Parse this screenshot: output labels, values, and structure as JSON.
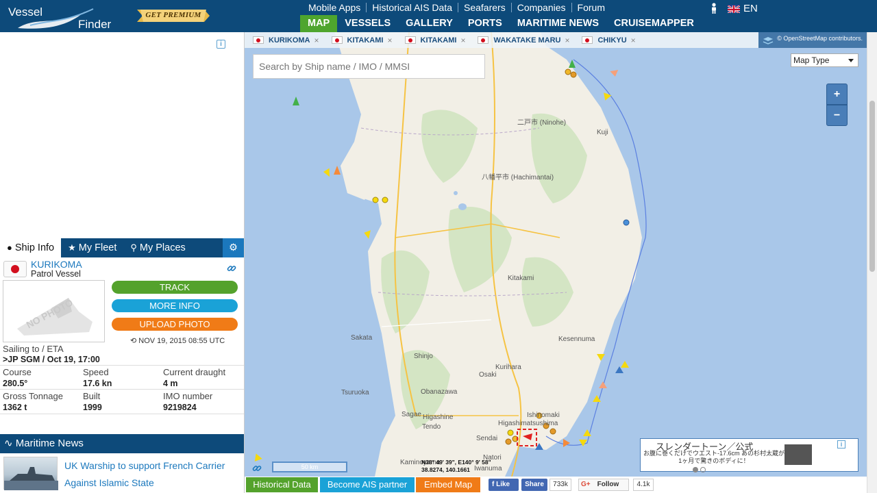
{
  "header": {
    "logo_top": "Vessel",
    "logo_bottom": "Finder",
    "premium_label": "GET PREMIUM",
    "top_links": [
      "Mobile Apps",
      "Historical AIS Data",
      "Seafarers",
      "Companies",
      "Forum"
    ],
    "main_nav": [
      "MAP",
      "VESSELS",
      "GALLERY",
      "PORTS",
      "MARITIME NEWS",
      "CRUISEMAPPER"
    ],
    "active_nav": "MAP",
    "language": "EN"
  },
  "sidebar": {
    "tabs": [
      "Ship Info",
      "My Fleet",
      "My Places"
    ],
    "ship": {
      "name": "KURIKOMA",
      "type": "Patrol Vessel",
      "no_photo_text": "NO PHOTO",
      "buttons": [
        "TRACK",
        "MORE INFO",
        "UPLOAD PHOTO"
      ],
      "date": "NOV 19, 2015 08:55 UTC",
      "eta_label": "Sailing to / ETA",
      "eta_value": ">JP SGM / Oct 19, 17:00",
      "stats": [
        {
          "label": "Course",
          "value": "280.5°"
        },
        {
          "label": "Speed",
          "value": "17.6 kn"
        },
        {
          "label": "Current draught",
          "value": "4 m"
        },
        {
          "label": "Gross Tonnage",
          "value": "1362 t"
        },
        {
          "label": "Built",
          "value": "1999"
        },
        {
          "label": "IMO number",
          "value": "9219824"
        }
      ]
    },
    "news": {
      "heading": "Maritime News",
      "title": "UK Warship to support French Carrier Against Islamic State"
    }
  },
  "map": {
    "ship_tabs": [
      "KURIKOMA",
      "KITAKAMI",
      "KITAKAMI",
      "WAKATAKE MARU",
      "CHIKYU"
    ],
    "credit": "© OpenStreetMap contributors.",
    "search_placeholder": "Search by Ship name / IMO / MMSI",
    "map_type": "Map Type",
    "zoom_in": "+",
    "zoom_out": "−",
    "scale": "50 km",
    "coords_line1": "N38° 49' 39\", E140° 9' 58\"",
    "coords_line2": "38.8274, 140.1661",
    "places": [
      {
        "name": "二戸市 (Ninohe)"
      },
      {
        "name": "Kuji"
      },
      {
        "name": "八幡平市 (Hachimantai)"
      },
      {
        "name": "Kitakami"
      },
      {
        "name": "Kesennuma"
      },
      {
        "name": "Sakata"
      },
      {
        "name": "Shinjo"
      },
      {
        "name": "Kurihara"
      },
      {
        "name": "Osaki"
      },
      {
        "name": "Tsuruoka"
      },
      {
        "name": "Obanazawa"
      },
      {
        "name": "Sagae"
      },
      {
        "name": "Higashine"
      },
      {
        "name": "Tendo"
      },
      {
        "name": "Sendai"
      },
      {
        "name": "Ishinomaki"
      },
      {
        "name": "Higashimatsushima"
      },
      {
        "name": "Natori"
      },
      {
        "name": "Kaminoyama"
      },
      {
        "name": "Iwanuma"
      }
    ],
    "ad": {
      "title": "スレンダートーン／公式",
      "text": "お腹に巻くだけでウエスト-17.6cm あの杉村太蔵が1ヶ月で驚きのボディに！"
    }
  },
  "bottom_bar": {
    "historical": "Historical Data",
    "ais_partner": "Become AIS partner",
    "embed": "Embed Map",
    "fb_like": "Like",
    "fb_share": "Share",
    "fb_count": "733k",
    "gplus_follow": "Follow",
    "gplus_count": "4.1k"
  },
  "colors": {
    "header_bg": "#0d4a7a",
    "nav_active": "#4ea52e",
    "track": "#54a22c",
    "more_info": "#1aa2d7",
    "upload": "#f07b17",
    "water": "#a9c7e9",
    "land": "#f2efe6"
  }
}
